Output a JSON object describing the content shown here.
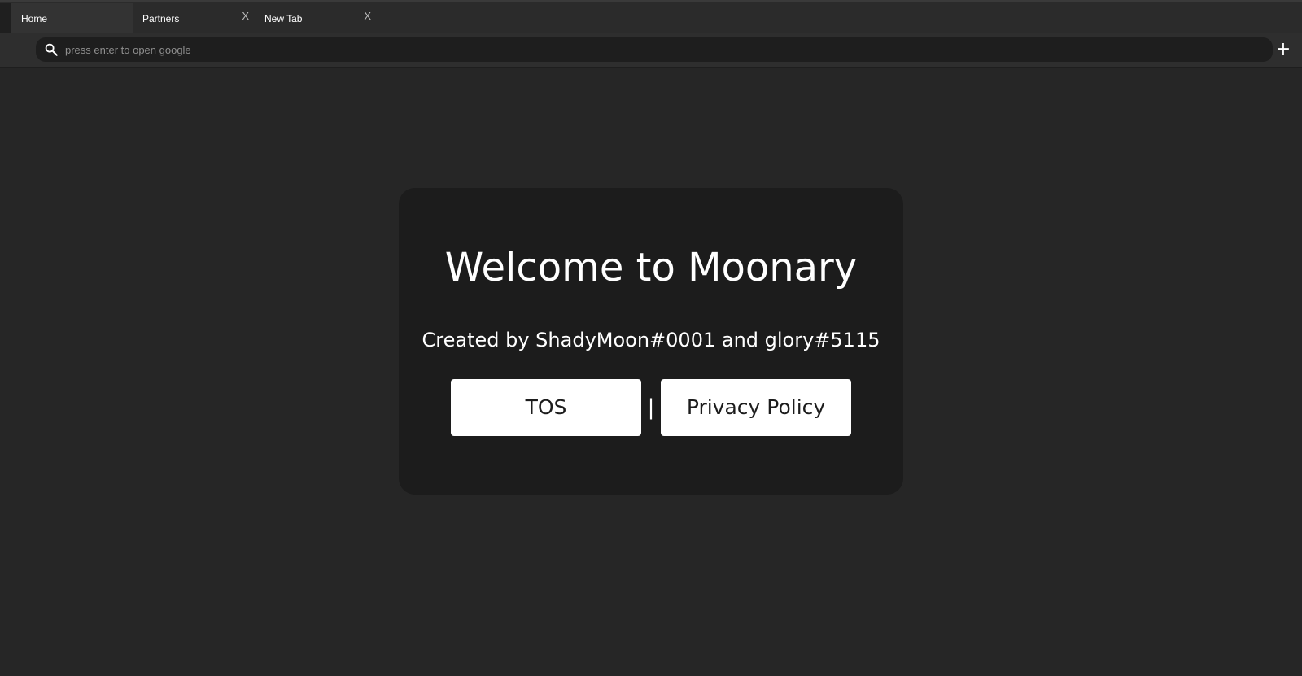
{
  "tabs": [
    {
      "label": "Home",
      "active": true,
      "closable": false
    },
    {
      "label": "Partners",
      "active": false,
      "closable": true,
      "close_label": "X"
    },
    {
      "label": "New Tab",
      "active": false,
      "closable": true,
      "close_label": "X"
    }
  ],
  "search": {
    "placeholder": "press enter to open google",
    "value": "",
    "icon": "search-icon"
  },
  "toolbar": {
    "new_tab_label": "+"
  },
  "welcome": {
    "title": "Welcome to Moonary",
    "subtitle": "Created by ShadyMoon#0001 and glory#5115",
    "tos_label": "TOS",
    "separator": "|",
    "privacy_label": "Privacy Policy"
  },
  "colors": {
    "background": "#262626",
    "card": "#1c1c1c",
    "button": "#ffffff",
    "text": "#ffffff"
  }
}
